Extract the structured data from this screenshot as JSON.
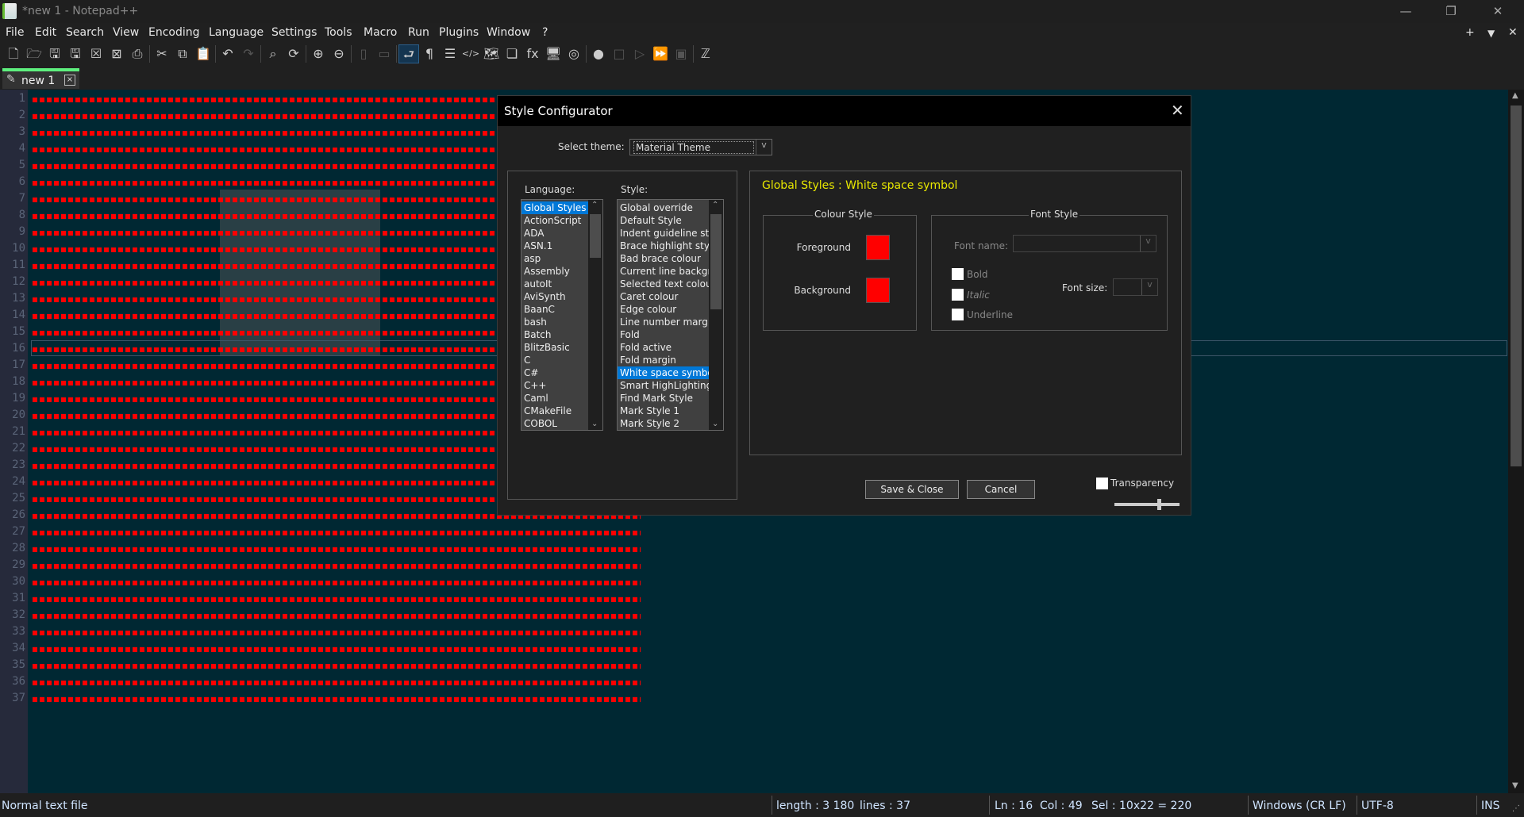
{
  "window": {
    "title": "*new 1 - Notepad++",
    "minimize": "—",
    "restore": "❐",
    "close": "✕"
  },
  "menu": [
    "File",
    "Edit",
    "Search",
    "View",
    "Encoding",
    "Language",
    "Settings",
    "Tools",
    "Macro",
    "Run",
    "Plugins",
    "Window",
    "?"
  ],
  "menu_right": {
    "add": "+",
    "dropdown": "▼",
    "close": "✕"
  },
  "toolbar": [
    {
      "name": "new-file-icon",
      "glyph": "🗋"
    },
    {
      "name": "open-file-icon",
      "glyph": "🗁"
    },
    {
      "name": "save-icon",
      "glyph": "🖫"
    },
    {
      "name": "save-all-icon",
      "glyph": "🖫"
    },
    {
      "name": "close-icon",
      "glyph": "☒"
    },
    {
      "name": "close-all-icon",
      "glyph": "⊠"
    },
    {
      "name": "print-icon",
      "glyph": "⎙"
    },
    {
      "sep": true
    },
    {
      "name": "cut-icon",
      "glyph": "✂"
    },
    {
      "name": "copy-icon",
      "glyph": "⧉"
    },
    {
      "name": "paste-icon",
      "glyph": "📋"
    },
    {
      "sep": true
    },
    {
      "name": "undo-icon",
      "glyph": "↶"
    },
    {
      "name": "redo-icon",
      "glyph": "↷",
      "dim": true
    },
    {
      "sep": true
    },
    {
      "name": "find-icon",
      "glyph": "⌕"
    },
    {
      "name": "replace-icon",
      "glyph": "⟳"
    },
    {
      "sep": true
    },
    {
      "name": "zoom-in-icon",
      "glyph": "⊕"
    },
    {
      "name": "zoom-out-icon",
      "glyph": "⊖"
    },
    {
      "sep": true
    },
    {
      "name": "sync-vertical-icon",
      "glyph": "▯",
      "dim": true
    },
    {
      "name": "sync-horizontal-icon",
      "glyph": "▭",
      "dim": true
    },
    {
      "sep": true
    },
    {
      "name": "word-wrap-icon",
      "glyph": "⮐",
      "active": true
    },
    {
      "name": "show-all-chars-icon",
      "glyph": "¶"
    },
    {
      "name": "indent-guide-icon",
      "glyph": "☰"
    },
    {
      "name": "xml-tags-icon",
      "glyph": "</>"
    },
    {
      "name": "document-map-icon",
      "glyph": "🗺"
    },
    {
      "name": "document-list-icon",
      "glyph": "❏"
    },
    {
      "name": "function-list-icon",
      "glyph": "fx"
    },
    {
      "name": "folder-workspace-icon",
      "glyph": "🖥"
    },
    {
      "name": "monitoring-icon",
      "glyph": "◎"
    },
    {
      "sep": true
    },
    {
      "name": "record-macro-icon",
      "glyph": "●"
    },
    {
      "name": "stop-macro-icon",
      "glyph": "□",
      "dim": true
    },
    {
      "name": "play-macro-icon",
      "glyph": "▷",
      "dim": true
    },
    {
      "name": "run-macro-multiple-icon",
      "glyph": "⏩"
    },
    {
      "name": "save-macro-icon",
      "glyph": "▣",
      "dim": true
    },
    {
      "sep": true
    },
    {
      "name": "spell-check-icon",
      "glyph": "ℤ"
    }
  ],
  "tab": {
    "label": "new 1",
    "close": "×"
  },
  "line_numbers": [
    1,
    2,
    3,
    4,
    5,
    6,
    7,
    8,
    9,
    10,
    11,
    12,
    13,
    14,
    15,
    16,
    17,
    18,
    19,
    20,
    21,
    22,
    23,
    24,
    25,
    26,
    27,
    28,
    29,
    30,
    31,
    32,
    33,
    34,
    35,
    36,
    37
  ],
  "colors": {
    "whitespace_symbol": "#ff0000",
    "editor_bg": "#002833",
    "accent": "#0078d7",
    "tab_indicator": "#5ef07e",
    "style_title": "#e6e600"
  },
  "status": {
    "file_type": "Normal text file",
    "length": "length : 3 180",
    "lines": "lines : 37",
    "ln": "Ln : 16",
    "col": "Col : 49",
    "sel": "Sel : 10x22 = 220",
    "eol": "Windows (CR LF)",
    "encoding": "UTF-8",
    "mode": "INS"
  },
  "dialog": {
    "title": "Style Configurator",
    "close": "✕",
    "select_theme_label": "Select theme:",
    "theme_value": "Material Theme",
    "combo_arrow": "v",
    "language_label": "Language:",
    "style_label": "Style:",
    "languages": [
      "Global Styles",
      "ActionScript",
      "ADA",
      "ASN.1",
      "asp",
      "Assembly",
      "autoIt",
      "AviSynth",
      "BaanC",
      "bash",
      "Batch",
      "BlitzBasic",
      "C",
      "C#",
      "C++",
      "Caml",
      "CMakeFile",
      "COBOL"
    ],
    "selected_language": "Global Styles",
    "styles": [
      "Global override",
      "Default Style",
      "Indent guideline style",
      "Brace highlight style",
      "Bad brace colour",
      "Current line background",
      "Selected text colour",
      "Caret colour",
      "Edge colour",
      "Line number margin",
      "Fold",
      "Fold active",
      "Fold margin",
      "White space symbol",
      "Smart HighLighting",
      "Find Mark Style",
      "Mark Style 1",
      "Mark Style 2"
    ],
    "selected_style": "White space symbol",
    "style_heading": "Global Styles : White space symbol",
    "colour_style_title": "Colour Style",
    "foreground_label": "Foreground",
    "background_label": "Background",
    "foreground_color": "#ff0000",
    "background_color": "#ff0000",
    "font_style_title": "Font Style",
    "font_name_label": "Font name:",
    "font_name_value": "",
    "font_size_label": "Font size:",
    "font_size_value": "",
    "bold_label": "Bold",
    "italic_label": "Italic",
    "underline_label": "Underline",
    "bold": false,
    "italic": false,
    "underline": false,
    "save_close": "Save & Close",
    "cancel": "Cancel",
    "transparency_label": "Transparency",
    "transparency_enabled": false,
    "transparency_level": 0.7
  }
}
